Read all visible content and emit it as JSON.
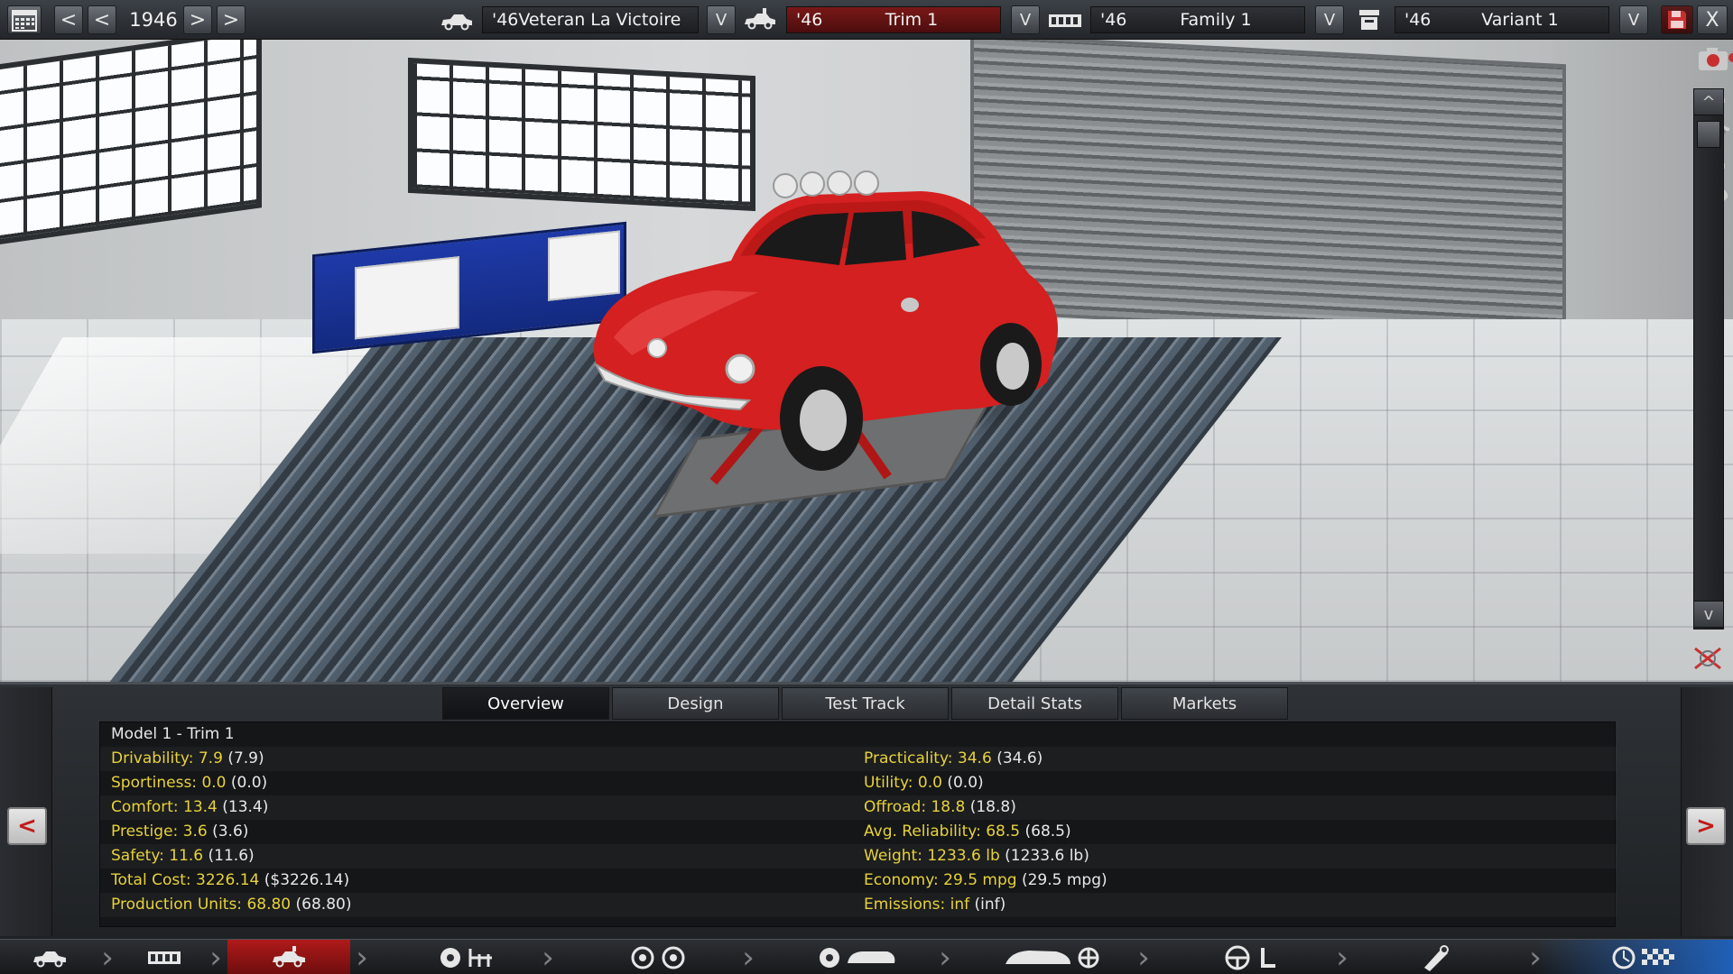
{
  "topbar": {
    "year": "1946",
    "model": {
      "prefix": "'46",
      "name": "Veteran La Victoire"
    },
    "trim": {
      "prefix": "'46",
      "name": "Trim 1"
    },
    "family": {
      "prefix": "'46",
      "name": "Family 1"
    },
    "variant": {
      "prefix": "'46",
      "name": "Variant 1"
    },
    "arrow_prev": "<",
    "arrow_next": ">",
    "dropdown_glyph": "V",
    "close_glyph": "X"
  },
  "camera": {
    "scroll_up": "^",
    "scroll_down": "v"
  },
  "tabs": [
    {
      "label": "Overview",
      "active": true
    },
    {
      "label": "Design",
      "active": false
    },
    {
      "label": "Test Track",
      "active": false
    },
    {
      "label": "Detail Stats",
      "active": false
    },
    {
      "label": "Markets",
      "active": false
    }
  ],
  "overview": {
    "title": "Model 1 - Trim 1",
    "left": [
      {
        "key": "Drivability: 7.9",
        "val": "(7.9)"
      },
      {
        "key": "Sportiness: 0.0",
        "val": "(0.0)"
      },
      {
        "key": "Comfort: 13.4",
        "val": "(13.4)"
      },
      {
        "key": "Prestige: 3.6",
        "val": "(3.6)"
      },
      {
        "key": "Safety: 11.6",
        "val": "(11.6)"
      },
      {
        "key": "Total Cost: 3226.14",
        "val": "($3226.14)"
      },
      {
        "key": "Production Units: 68.80",
        "val": "(68.80)"
      }
    ],
    "right": [
      {
        "key": "Practicality: 34.6",
        "val": "(34.6)"
      },
      {
        "key": "Utility: 0.0",
        "val": "(0.0)"
      },
      {
        "key": "Offroad: 18.8",
        "val": "(18.8)"
      },
      {
        "key": "Avg. Reliability: 68.5",
        "val": "(68.5)"
      },
      {
        "key": "Weight: 1233.6 lb",
        "val": "(1233.6 lb)"
      },
      {
        "key": "Economy: 29.5 mpg",
        "val": "(29.5 mpg)"
      },
      {
        "key": "Emissions: inf",
        "val": "(inf)"
      }
    ]
  },
  "side_nav": {
    "prev": "<",
    "next": ">"
  },
  "colors": {
    "accent_red": "#b01a1a",
    "stat_key": "#e8d23a",
    "car_red": "#d42020"
  }
}
